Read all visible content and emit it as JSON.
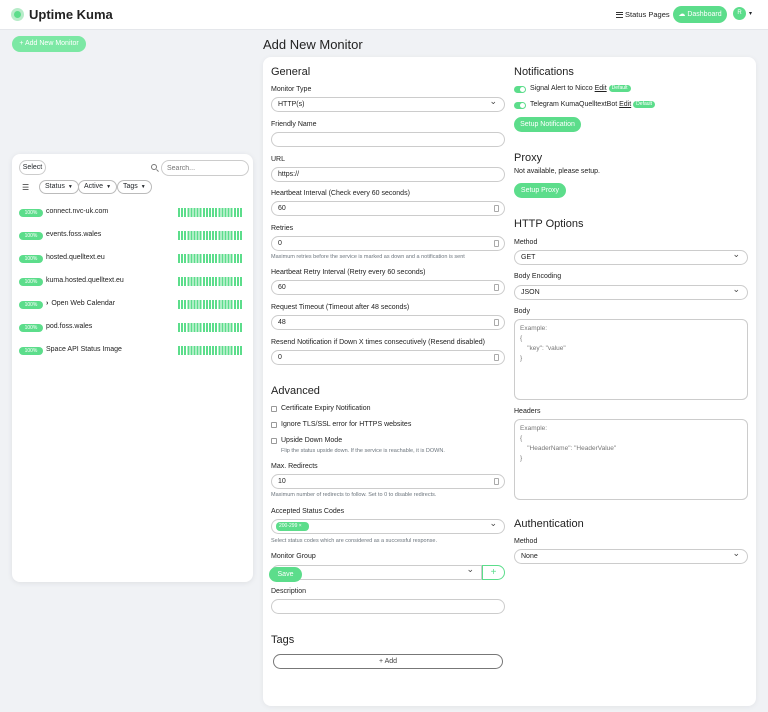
{
  "header": {
    "brand": "Uptime Kuma",
    "status_pages": "Status Pages",
    "dashboard": "Dashboard",
    "avatar_initial": "R"
  },
  "sidebar": {
    "add_button": "+ Add New Monitor",
    "select_label": "Select",
    "search_placeholder": "Search...",
    "filters": [
      "Status",
      "Active",
      "Tags"
    ],
    "monitors": [
      {
        "pct": "100%",
        "name": "connect.nvc-uk.com"
      },
      {
        "pct": "100%",
        "name": "events.foss.wales"
      },
      {
        "pct": "100%",
        "name": "hosted.quelltext.eu"
      },
      {
        "pct": "100%",
        "name": "kuma.hosted.quelltext.eu"
      },
      {
        "pct": "100%",
        "name": "Open Web Calendar"
      },
      {
        "pct": "100%",
        "name": "pod.foss.wales"
      },
      {
        "pct": "100%",
        "name": "Space API Status Image"
      }
    ]
  },
  "page": {
    "title": "Add New Monitor"
  },
  "general": {
    "heading": "General",
    "monitor_type_label": "Monitor Type",
    "monitor_type": "HTTP(s)",
    "friendly_name_label": "Friendly Name",
    "url_label": "URL",
    "url": "https://",
    "heartbeat_label": "Heartbeat Interval (Check every 60 seconds)",
    "heartbeat": "60",
    "retries_label": "Retries",
    "retries": "0",
    "retries_help": "Maximum retries before the service is marked as down and a notification is sent",
    "retry_interval_label": "Heartbeat Retry Interval (Retry every 60 seconds)",
    "retry_interval": "60",
    "timeout_label": "Request Timeout (Timeout after 48 seconds)",
    "timeout": "48",
    "resend_label": "Resend Notification if Down X times consecutively (Resend disabled)",
    "resend": "0"
  },
  "advanced": {
    "heading": "Advanced",
    "cert_expiry": "Certificate Expiry Notification",
    "ignore_tls": "Ignore TLS/SSL error for HTTPS websites",
    "upside_down": "Upside Down Mode",
    "upside_down_help": "Flip the status upside down. If the service is reachable, it is DOWN.",
    "max_redirects_label": "Max. Redirects",
    "max_redirects": "10",
    "max_redirects_help": "Maximum number of redirects to follow. Set to 0 to disable redirects.",
    "status_codes_label": "Accepted Status Codes",
    "status_code_chip": "200-299",
    "status_codes_help": "Select status codes which are considered as a successful response.",
    "monitor_group_label": "Monitor Group",
    "save": "Save",
    "description_label": "Description"
  },
  "tags": {
    "heading": "Tags",
    "add": "+ Add"
  },
  "notifications": {
    "heading": "Notifications",
    "items": [
      {
        "text": "Signal Alert to Nicco",
        "edit": "Edit",
        "badge": "Default"
      },
      {
        "text": "Telegram KumaQuelltextBot",
        "edit": "Edit",
        "badge": "Default"
      }
    ],
    "setup": "Setup Notification"
  },
  "proxy": {
    "heading": "Proxy",
    "text": "Not available, please setup.",
    "setup": "Setup Proxy"
  },
  "http": {
    "heading": "HTTP Options",
    "method_label": "Method",
    "method": "GET",
    "encoding_label": "Body Encoding",
    "encoding": "JSON",
    "body_label": "Body",
    "body_placeholder": "Example:\n{\n    \"key\": \"value\"\n}",
    "headers_label": "Headers",
    "headers_placeholder": "Example:\n{\n    \"HeaderName\": \"HeaderValue\"\n}"
  },
  "auth": {
    "heading": "Authentication",
    "method_label": "Method",
    "method": "None"
  },
  "colors": {
    "accent": "#5cdd8b"
  }
}
